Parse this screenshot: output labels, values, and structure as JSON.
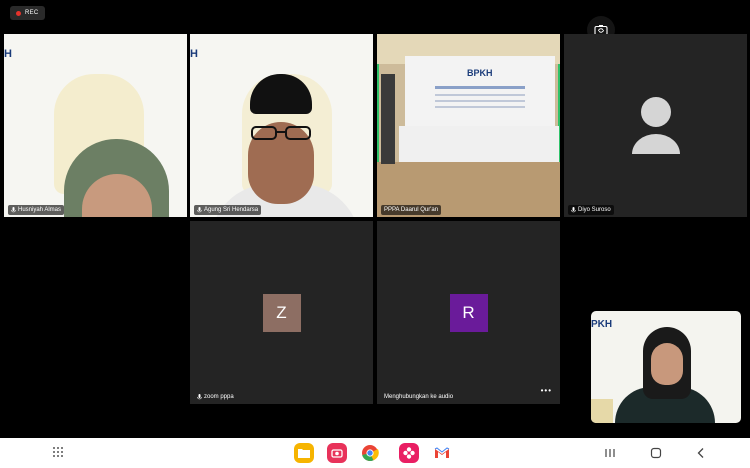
{
  "recording": {
    "label": "REC",
    "icon": "recording-dot-icon"
  },
  "camera_switch": {
    "icon": "camera-switch-icon"
  },
  "participants": [
    {
      "name": "Husniyah Almas",
      "logo": "H"
    },
    {
      "name": "Agung Sri Hendarsa",
      "logo": "H"
    },
    {
      "name": "PPPA Daarul Qur'an",
      "banner_text": "BPKH"
    },
    {
      "name": "Diyo Suroso",
      "icon": "person-avatar-icon"
    },
    {
      "name": "zoom pppa",
      "initial": "Z",
      "avatar_color": "#8d6e63"
    },
    {
      "status": "Menghubungkan ke audio",
      "initial": "R",
      "avatar_color": "#6a1b9a"
    }
  ],
  "self_view": {
    "logo": "PKH"
  },
  "navbar": {
    "apps": [
      {
        "name": "files-app-icon",
        "color": "#f6b400"
      },
      {
        "name": "screen-recorder-app-icon",
        "color": "#e8325a"
      },
      {
        "name": "chrome-app-icon",
        "color": "#4285f4"
      },
      {
        "name": "flower-app-icon",
        "color": "#e91e63"
      },
      {
        "name": "gmail-app-icon",
        "color": "#ea4335"
      }
    ],
    "system": [
      "recent-apps-icon",
      "home-icon",
      "back-icon"
    ]
  }
}
